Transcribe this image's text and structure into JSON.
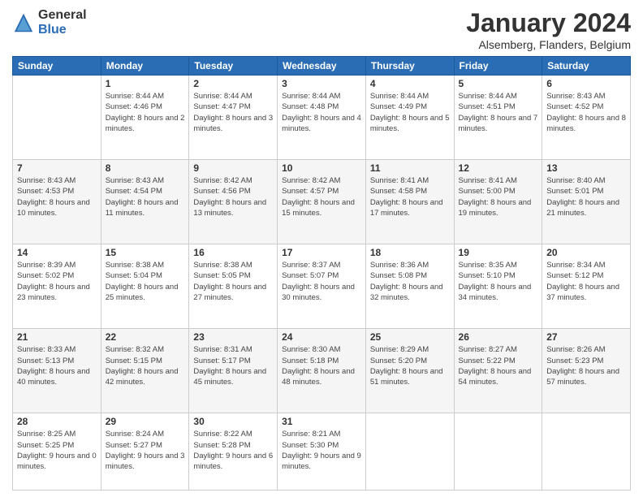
{
  "logo": {
    "general": "General",
    "blue": "Blue"
  },
  "header": {
    "title": "January 2024",
    "subtitle": "Alsemberg, Flanders, Belgium"
  },
  "days_of_week": [
    "Sunday",
    "Monday",
    "Tuesday",
    "Wednesday",
    "Thursday",
    "Friday",
    "Saturday"
  ],
  "weeks": [
    [
      {
        "day": "",
        "sunrise": "",
        "sunset": "",
        "daylight": ""
      },
      {
        "day": "1",
        "sunrise": "Sunrise: 8:44 AM",
        "sunset": "Sunset: 4:46 PM",
        "daylight": "Daylight: 8 hours and 2 minutes."
      },
      {
        "day": "2",
        "sunrise": "Sunrise: 8:44 AM",
        "sunset": "Sunset: 4:47 PM",
        "daylight": "Daylight: 8 hours and 3 minutes."
      },
      {
        "day": "3",
        "sunrise": "Sunrise: 8:44 AM",
        "sunset": "Sunset: 4:48 PM",
        "daylight": "Daylight: 8 hours and 4 minutes."
      },
      {
        "day": "4",
        "sunrise": "Sunrise: 8:44 AM",
        "sunset": "Sunset: 4:49 PM",
        "daylight": "Daylight: 8 hours and 5 minutes."
      },
      {
        "day": "5",
        "sunrise": "Sunrise: 8:44 AM",
        "sunset": "Sunset: 4:51 PM",
        "daylight": "Daylight: 8 hours and 7 minutes."
      },
      {
        "day": "6",
        "sunrise": "Sunrise: 8:43 AM",
        "sunset": "Sunset: 4:52 PM",
        "daylight": "Daylight: 8 hours and 8 minutes."
      }
    ],
    [
      {
        "day": "7",
        "sunrise": "Sunrise: 8:43 AM",
        "sunset": "Sunset: 4:53 PM",
        "daylight": "Daylight: 8 hours and 10 minutes."
      },
      {
        "day": "8",
        "sunrise": "Sunrise: 8:43 AM",
        "sunset": "Sunset: 4:54 PM",
        "daylight": "Daylight: 8 hours and 11 minutes."
      },
      {
        "day": "9",
        "sunrise": "Sunrise: 8:42 AM",
        "sunset": "Sunset: 4:56 PM",
        "daylight": "Daylight: 8 hours and 13 minutes."
      },
      {
        "day": "10",
        "sunrise": "Sunrise: 8:42 AM",
        "sunset": "Sunset: 4:57 PM",
        "daylight": "Daylight: 8 hours and 15 minutes."
      },
      {
        "day": "11",
        "sunrise": "Sunrise: 8:41 AM",
        "sunset": "Sunset: 4:58 PM",
        "daylight": "Daylight: 8 hours and 17 minutes."
      },
      {
        "day": "12",
        "sunrise": "Sunrise: 8:41 AM",
        "sunset": "Sunset: 5:00 PM",
        "daylight": "Daylight: 8 hours and 19 minutes."
      },
      {
        "day": "13",
        "sunrise": "Sunrise: 8:40 AM",
        "sunset": "Sunset: 5:01 PM",
        "daylight": "Daylight: 8 hours and 21 minutes."
      }
    ],
    [
      {
        "day": "14",
        "sunrise": "Sunrise: 8:39 AM",
        "sunset": "Sunset: 5:02 PM",
        "daylight": "Daylight: 8 hours and 23 minutes."
      },
      {
        "day": "15",
        "sunrise": "Sunrise: 8:38 AM",
        "sunset": "Sunset: 5:04 PM",
        "daylight": "Daylight: 8 hours and 25 minutes."
      },
      {
        "day": "16",
        "sunrise": "Sunrise: 8:38 AM",
        "sunset": "Sunset: 5:05 PM",
        "daylight": "Daylight: 8 hours and 27 minutes."
      },
      {
        "day": "17",
        "sunrise": "Sunrise: 8:37 AM",
        "sunset": "Sunset: 5:07 PM",
        "daylight": "Daylight: 8 hours and 30 minutes."
      },
      {
        "day": "18",
        "sunrise": "Sunrise: 8:36 AM",
        "sunset": "Sunset: 5:08 PM",
        "daylight": "Daylight: 8 hours and 32 minutes."
      },
      {
        "day": "19",
        "sunrise": "Sunrise: 8:35 AM",
        "sunset": "Sunset: 5:10 PM",
        "daylight": "Daylight: 8 hours and 34 minutes."
      },
      {
        "day": "20",
        "sunrise": "Sunrise: 8:34 AM",
        "sunset": "Sunset: 5:12 PM",
        "daylight": "Daylight: 8 hours and 37 minutes."
      }
    ],
    [
      {
        "day": "21",
        "sunrise": "Sunrise: 8:33 AM",
        "sunset": "Sunset: 5:13 PM",
        "daylight": "Daylight: 8 hours and 40 minutes."
      },
      {
        "day": "22",
        "sunrise": "Sunrise: 8:32 AM",
        "sunset": "Sunset: 5:15 PM",
        "daylight": "Daylight: 8 hours and 42 minutes."
      },
      {
        "day": "23",
        "sunrise": "Sunrise: 8:31 AM",
        "sunset": "Sunset: 5:17 PM",
        "daylight": "Daylight: 8 hours and 45 minutes."
      },
      {
        "day": "24",
        "sunrise": "Sunrise: 8:30 AM",
        "sunset": "Sunset: 5:18 PM",
        "daylight": "Daylight: 8 hours and 48 minutes."
      },
      {
        "day": "25",
        "sunrise": "Sunrise: 8:29 AM",
        "sunset": "Sunset: 5:20 PM",
        "daylight": "Daylight: 8 hours and 51 minutes."
      },
      {
        "day": "26",
        "sunrise": "Sunrise: 8:27 AM",
        "sunset": "Sunset: 5:22 PM",
        "daylight": "Daylight: 8 hours and 54 minutes."
      },
      {
        "day": "27",
        "sunrise": "Sunrise: 8:26 AM",
        "sunset": "Sunset: 5:23 PM",
        "daylight": "Daylight: 8 hours and 57 minutes."
      }
    ],
    [
      {
        "day": "28",
        "sunrise": "Sunrise: 8:25 AM",
        "sunset": "Sunset: 5:25 PM",
        "daylight": "Daylight: 9 hours and 0 minutes."
      },
      {
        "day": "29",
        "sunrise": "Sunrise: 8:24 AM",
        "sunset": "Sunset: 5:27 PM",
        "daylight": "Daylight: 9 hours and 3 minutes."
      },
      {
        "day": "30",
        "sunrise": "Sunrise: 8:22 AM",
        "sunset": "Sunset: 5:28 PM",
        "daylight": "Daylight: 9 hours and 6 minutes."
      },
      {
        "day": "31",
        "sunrise": "Sunrise: 8:21 AM",
        "sunset": "Sunset: 5:30 PM",
        "daylight": "Daylight: 9 hours and 9 minutes."
      },
      {
        "day": "",
        "sunrise": "",
        "sunset": "",
        "daylight": ""
      },
      {
        "day": "",
        "sunrise": "",
        "sunset": "",
        "daylight": ""
      },
      {
        "day": "",
        "sunrise": "",
        "sunset": "",
        "daylight": ""
      }
    ]
  ]
}
